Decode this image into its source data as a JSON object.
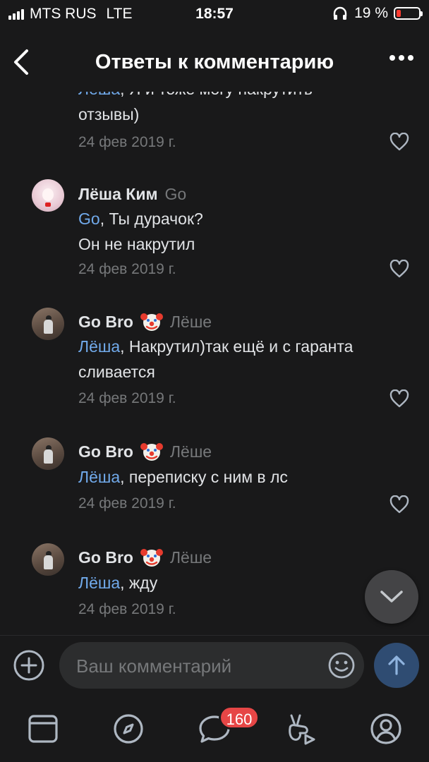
{
  "status_bar": {
    "carrier": "MTS RUS",
    "network": "LTE",
    "time": "18:57",
    "battery_percent": "19 %",
    "battery_level": 0.19,
    "battery_color": "#ff3b30"
  },
  "header": {
    "title": "Ответы к комментарию"
  },
  "comments": [
    {
      "mention": "Лёша",
      "text_rest": ", Я и тоже могу накрутить",
      "line2": "отзывы)",
      "date": "24 фев 2019 г."
    },
    {
      "author": "Лёша Ким",
      "reply_to": "Go",
      "mention": "Go",
      "text_rest": ", Ты дурачок?",
      "line2": "Он не накрутил",
      "date": "24 фев 2019 г."
    },
    {
      "author": "Go Bro",
      "reply_to": "Лёше",
      "mention": "Лёша",
      "text_rest": ", Накрутил)так ещё и с гаранта",
      "line2": "сливается",
      "date": "24 фев 2019 г."
    },
    {
      "author": "Go Bro",
      "reply_to": "Лёше",
      "mention": "Лёша",
      "text_rest": ", переписку с ним в лс",
      "date": "24 фев 2019 г."
    },
    {
      "author": "Go Bro",
      "reply_to": "Лёше",
      "mention": "Лёша",
      "text_rest": ", жду",
      "date": "24 фев 2019 г."
    }
  ],
  "composer": {
    "placeholder": "Ваш комментарий"
  },
  "tabbar": {
    "messages_badge": "160",
    "tabs": [
      "news-tab",
      "discover-tab",
      "messages-tab",
      "clips-tab",
      "profile-tab"
    ]
  },
  "colors": {
    "background": "#19191a",
    "mention": "#71aaeb",
    "secondary_text": "#76787a",
    "badge": "#e64646",
    "send_button": "#2f4c72"
  }
}
